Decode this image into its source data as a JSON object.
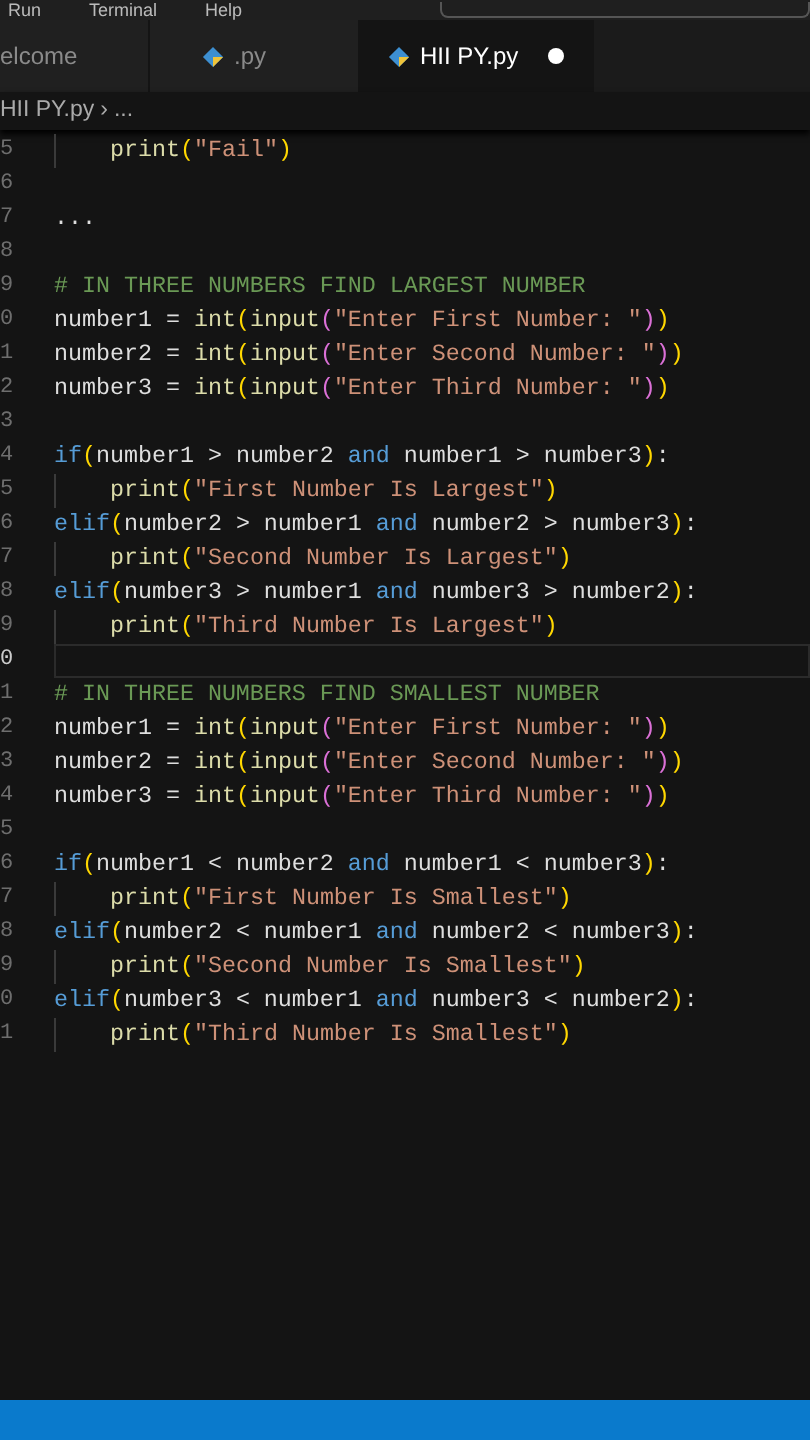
{
  "menu": [
    "Run",
    "Terminal",
    "Help"
  ],
  "tabs": [
    {
      "label": "elcome",
      "icon": false,
      "selected": false,
      "modified": false
    },
    {
      "label": ".py",
      "icon": true,
      "selected": false,
      "modified": false
    },
    {
      "label": "HII PY.py",
      "icon": true,
      "selected": true,
      "modified": true
    }
  ],
  "breadcrumb": {
    "file": "HII PY.py",
    "separator": "›",
    "rest": "..."
  },
  "lines": [
    {
      "number": "5",
      "indented": true,
      "current": false,
      "tokens": [
        {
          "kind": "fn",
          "text": "print"
        },
        {
          "kind": "p1",
          "text": "("
        },
        {
          "kind": "str",
          "text": "\"Fail\""
        },
        {
          "kind": "p1",
          "text": ")"
        }
      ]
    },
    {
      "number": "6",
      "indented": false,
      "current": false
    },
    {
      "number": "7",
      "indented": false,
      "current": false,
      "tokens": [
        {
          "kind": "txt",
          "text": "..."
        }
      ]
    },
    {
      "number": "8",
      "indented": false,
      "current": false
    },
    {
      "number": "9",
      "indented": false,
      "current": false,
      "tokens": [
        {
          "kind": "cm",
          "text": "# IN THREE NUMBERS FIND LARGEST NUMBER"
        }
      ]
    },
    {
      "number": "0",
      "indented": false,
      "current": false,
      "tokens": [
        {
          "kind": "txt",
          "text": "number1 = "
        },
        {
          "kind": "fn",
          "text": "int"
        },
        {
          "kind": "p1",
          "text": "("
        },
        {
          "kind": "fn",
          "text": "input"
        },
        {
          "kind": "p2",
          "text": "("
        },
        {
          "kind": "str",
          "text": "\"Enter First Number: \""
        },
        {
          "kind": "p2",
          "text": ")"
        },
        {
          "kind": "p1",
          "text": ")"
        }
      ]
    },
    {
      "number": "1",
      "indented": false,
      "current": false,
      "tokens": [
        {
          "kind": "txt",
          "text": "number2 = "
        },
        {
          "kind": "fn",
          "text": "int"
        },
        {
          "kind": "p1",
          "text": "("
        },
        {
          "kind": "fn",
          "text": "input"
        },
        {
          "kind": "p2",
          "text": "("
        },
        {
          "kind": "str",
          "text": "\"Enter Second Number: \""
        },
        {
          "kind": "p2",
          "text": ")"
        },
        {
          "kind": "p1",
          "text": ")"
        }
      ]
    },
    {
      "number": "2",
      "indented": false,
      "current": false,
      "tokens": [
        {
          "kind": "txt",
          "text": "number3 = "
        },
        {
          "kind": "fn",
          "text": "int"
        },
        {
          "kind": "p1",
          "text": "("
        },
        {
          "kind": "fn",
          "text": "input"
        },
        {
          "kind": "p2",
          "text": "("
        },
        {
          "kind": "str",
          "text": "\"Enter Third Number: \""
        },
        {
          "kind": "p2",
          "text": ")"
        },
        {
          "kind": "p1",
          "text": ")"
        }
      ]
    },
    {
      "number": "3",
      "indented": false,
      "current": false
    },
    {
      "number": "4",
      "indented": false,
      "current": false,
      "tokens": [
        {
          "kind": "kw",
          "text": "if"
        },
        {
          "kind": "p1",
          "text": "("
        },
        {
          "kind": "txt",
          "text": "number1 > number2 "
        },
        {
          "kind": "kw",
          "text": "and"
        },
        {
          "kind": "txt",
          "text": " number1 > number3"
        },
        {
          "kind": "p1",
          "text": ")"
        },
        {
          "kind": "txt",
          "text": ":"
        }
      ]
    },
    {
      "number": "5",
      "indented": true,
      "current": false,
      "tokens": [
        {
          "kind": "fn",
          "text": "print"
        },
        {
          "kind": "p1",
          "text": "("
        },
        {
          "kind": "str",
          "text": "\"First Number Is Largest\""
        },
        {
          "kind": "p1",
          "text": ")"
        }
      ]
    },
    {
      "number": "6",
      "indented": false,
      "current": false,
      "tokens": [
        {
          "kind": "kw",
          "text": "elif"
        },
        {
          "kind": "p1",
          "text": "("
        },
        {
          "kind": "txt",
          "text": "number2 > number1 "
        },
        {
          "kind": "kw",
          "text": "and"
        },
        {
          "kind": "txt",
          "text": " number2 > number3"
        },
        {
          "kind": "p1",
          "text": ")"
        },
        {
          "kind": "txt",
          "text": ":"
        }
      ]
    },
    {
      "number": "7",
      "indented": true,
      "current": false,
      "tokens": [
        {
          "kind": "fn",
          "text": "print"
        },
        {
          "kind": "p1",
          "text": "("
        },
        {
          "kind": "str",
          "text": "\"Second Number Is Largest\""
        },
        {
          "kind": "p1",
          "text": ")"
        }
      ]
    },
    {
      "number": "8",
      "indented": false,
      "current": false,
      "tokens": [
        {
          "kind": "kw",
          "text": "elif"
        },
        {
          "kind": "p1",
          "text": "("
        },
        {
          "kind": "txt",
          "text": "number3 > number1 "
        },
        {
          "kind": "kw",
          "text": "and"
        },
        {
          "kind": "txt",
          "text": " number3 > number2"
        },
        {
          "kind": "p1",
          "text": ")"
        },
        {
          "kind": "txt",
          "text": ":"
        }
      ]
    },
    {
      "number": "9",
      "indented": true,
      "current": false,
      "tokens": [
        {
          "kind": "fn",
          "text": "print"
        },
        {
          "kind": "p1",
          "text": "("
        },
        {
          "kind": "str",
          "text": "\"Third Number Is Largest\""
        },
        {
          "kind": "p1",
          "text": ")"
        }
      ]
    },
    {
      "number": "0",
      "indented": false,
      "current": true
    },
    {
      "number": "1",
      "indented": false,
      "current": false,
      "tokens": [
        {
          "kind": "cm",
          "text": "# IN THREE NUMBERS FIND SMALLEST NUMBER"
        }
      ]
    },
    {
      "number": "2",
      "indented": false,
      "current": false,
      "tokens": [
        {
          "kind": "txt",
          "text": "number1 = "
        },
        {
          "kind": "fn",
          "text": "int"
        },
        {
          "kind": "p1",
          "text": "("
        },
        {
          "kind": "fn",
          "text": "input"
        },
        {
          "kind": "p2",
          "text": "("
        },
        {
          "kind": "str",
          "text": "\"Enter First Number: \""
        },
        {
          "kind": "p2",
          "text": ")"
        },
        {
          "kind": "p1",
          "text": ")"
        }
      ]
    },
    {
      "number": "3",
      "indented": false,
      "current": false,
      "tokens": [
        {
          "kind": "txt",
          "text": "number2 = "
        },
        {
          "kind": "fn",
          "text": "int"
        },
        {
          "kind": "p1",
          "text": "("
        },
        {
          "kind": "fn",
          "text": "input"
        },
        {
          "kind": "p2",
          "text": "("
        },
        {
          "kind": "str",
          "text": "\"Enter Second Number: \""
        },
        {
          "kind": "p2",
          "text": ")"
        },
        {
          "kind": "p1",
          "text": ")"
        }
      ]
    },
    {
      "number": "4",
      "indented": false,
      "current": false,
      "tokens": [
        {
          "kind": "txt",
          "text": "number3 = "
        },
        {
          "kind": "fn",
          "text": "int"
        },
        {
          "kind": "p1",
          "text": "("
        },
        {
          "kind": "fn",
          "text": "input"
        },
        {
          "kind": "p2",
          "text": "("
        },
        {
          "kind": "str",
          "text": "\"Enter Third Number: \""
        },
        {
          "kind": "p2",
          "text": ")"
        },
        {
          "kind": "p1",
          "text": ")"
        }
      ]
    },
    {
      "number": "5",
      "indented": false,
      "current": false
    },
    {
      "number": "6",
      "indented": false,
      "current": false,
      "tokens": [
        {
          "kind": "kw",
          "text": "if"
        },
        {
          "kind": "p1",
          "text": "("
        },
        {
          "kind": "txt",
          "text": "number1 < number2 "
        },
        {
          "kind": "kw",
          "text": "and"
        },
        {
          "kind": "txt",
          "text": " number1 < number3"
        },
        {
          "kind": "p1",
          "text": ")"
        },
        {
          "kind": "txt",
          "text": ":"
        }
      ]
    },
    {
      "number": "7",
      "indented": true,
      "current": false,
      "tokens": [
        {
          "kind": "fn",
          "text": "print"
        },
        {
          "kind": "p1",
          "text": "("
        },
        {
          "kind": "str",
          "text": "\"First Number Is Smallest\""
        },
        {
          "kind": "p1",
          "text": ")"
        }
      ]
    },
    {
      "number": "8",
      "indented": false,
      "current": false,
      "tokens": [
        {
          "kind": "kw",
          "text": "elif"
        },
        {
          "kind": "p1",
          "text": "("
        },
        {
          "kind": "txt",
          "text": "number2 < number1 "
        },
        {
          "kind": "kw",
          "text": "and"
        },
        {
          "kind": "txt",
          "text": " number2 < number3"
        },
        {
          "kind": "p1",
          "text": ")"
        },
        {
          "kind": "txt",
          "text": ":"
        }
      ]
    },
    {
      "number": "9",
      "indented": true,
      "current": false,
      "tokens": [
        {
          "kind": "fn",
          "text": "print"
        },
        {
          "kind": "p1",
          "text": "("
        },
        {
          "kind": "str",
          "text": "\"Second Number Is Smallest\""
        },
        {
          "kind": "p1",
          "text": ")"
        }
      ]
    },
    {
      "number": "0",
      "indented": false,
      "current": false,
      "tokens": [
        {
          "kind": "kw",
          "text": "elif"
        },
        {
          "kind": "p1",
          "text": "("
        },
        {
          "kind": "txt",
          "text": "number3 < number1 "
        },
        {
          "kind": "kw",
          "text": "and"
        },
        {
          "kind": "txt",
          "text": " number3 < number2"
        },
        {
          "kind": "p1",
          "text": ")"
        },
        {
          "kind": "txt",
          "text": ":"
        }
      ]
    },
    {
      "number": "1",
      "indented": true,
      "current": false,
      "tokens": [
        {
          "kind": "fn",
          "text": "print"
        },
        {
          "kind": "p1",
          "text": "("
        },
        {
          "kind": "str",
          "text": "\"Third Number Is Smallest\""
        },
        {
          "kind": "p1",
          "text": ")"
        }
      ]
    }
  ]
}
